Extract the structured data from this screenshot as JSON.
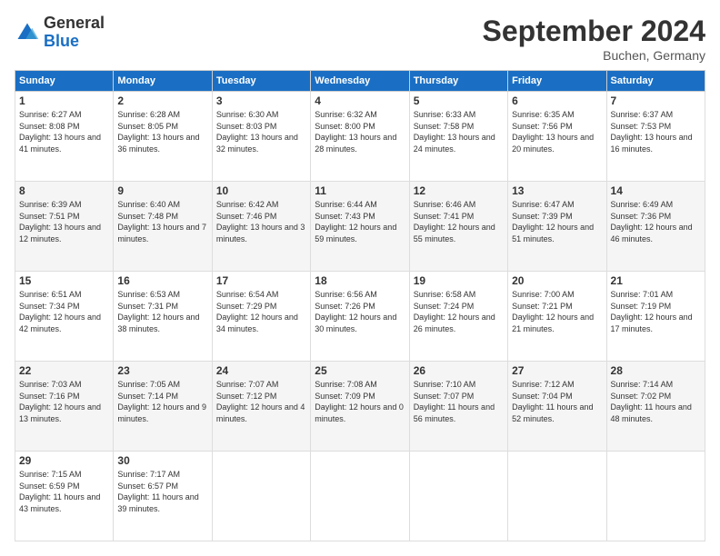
{
  "logo": {
    "general": "General",
    "blue": "Blue"
  },
  "header": {
    "month": "September 2024",
    "location": "Buchen, Germany"
  },
  "days": [
    "Sunday",
    "Monday",
    "Tuesday",
    "Wednesday",
    "Thursday",
    "Friday",
    "Saturday"
  ],
  "weeks": [
    [
      {
        "num": "1",
        "sunrise": "6:27 AM",
        "sunset": "8:08 PM",
        "daylight": "13 hours and 41 minutes."
      },
      {
        "num": "2",
        "sunrise": "6:28 AM",
        "sunset": "8:05 PM",
        "daylight": "13 hours and 36 minutes."
      },
      {
        "num": "3",
        "sunrise": "6:30 AM",
        "sunset": "8:03 PM",
        "daylight": "13 hours and 32 minutes."
      },
      {
        "num": "4",
        "sunrise": "6:32 AM",
        "sunset": "8:00 PM",
        "daylight": "13 hours and 28 minutes."
      },
      {
        "num": "5",
        "sunrise": "6:33 AM",
        "sunset": "7:58 PM",
        "daylight": "13 hours and 24 minutes."
      },
      {
        "num": "6",
        "sunrise": "6:35 AM",
        "sunset": "7:56 PM",
        "daylight": "13 hours and 20 minutes."
      },
      {
        "num": "7",
        "sunrise": "6:37 AM",
        "sunset": "7:53 PM",
        "daylight": "13 hours and 16 minutes."
      }
    ],
    [
      {
        "num": "8",
        "sunrise": "6:39 AM",
        "sunset": "7:51 PM",
        "daylight": "13 hours and 12 minutes."
      },
      {
        "num": "9",
        "sunrise": "6:40 AM",
        "sunset": "7:48 PM",
        "daylight": "13 hours and 7 minutes."
      },
      {
        "num": "10",
        "sunrise": "6:42 AM",
        "sunset": "7:46 PM",
        "daylight": "13 hours and 3 minutes."
      },
      {
        "num": "11",
        "sunrise": "6:44 AM",
        "sunset": "7:43 PM",
        "daylight": "12 hours and 59 minutes."
      },
      {
        "num": "12",
        "sunrise": "6:46 AM",
        "sunset": "7:41 PM",
        "daylight": "12 hours and 55 minutes."
      },
      {
        "num": "13",
        "sunrise": "6:47 AM",
        "sunset": "7:39 PM",
        "daylight": "12 hours and 51 minutes."
      },
      {
        "num": "14",
        "sunrise": "6:49 AM",
        "sunset": "7:36 PM",
        "daylight": "12 hours and 46 minutes."
      }
    ],
    [
      {
        "num": "15",
        "sunrise": "6:51 AM",
        "sunset": "7:34 PM",
        "daylight": "12 hours and 42 minutes."
      },
      {
        "num": "16",
        "sunrise": "6:53 AM",
        "sunset": "7:31 PM",
        "daylight": "12 hours and 38 minutes."
      },
      {
        "num": "17",
        "sunrise": "6:54 AM",
        "sunset": "7:29 PM",
        "daylight": "12 hours and 34 minutes."
      },
      {
        "num": "18",
        "sunrise": "6:56 AM",
        "sunset": "7:26 PM",
        "daylight": "12 hours and 30 minutes."
      },
      {
        "num": "19",
        "sunrise": "6:58 AM",
        "sunset": "7:24 PM",
        "daylight": "12 hours and 26 minutes."
      },
      {
        "num": "20",
        "sunrise": "7:00 AM",
        "sunset": "7:21 PM",
        "daylight": "12 hours and 21 minutes."
      },
      {
        "num": "21",
        "sunrise": "7:01 AM",
        "sunset": "7:19 PM",
        "daylight": "12 hours and 17 minutes."
      }
    ],
    [
      {
        "num": "22",
        "sunrise": "7:03 AM",
        "sunset": "7:16 PM",
        "daylight": "12 hours and 13 minutes."
      },
      {
        "num": "23",
        "sunrise": "7:05 AM",
        "sunset": "7:14 PM",
        "daylight": "12 hours and 9 minutes."
      },
      {
        "num": "24",
        "sunrise": "7:07 AM",
        "sunset": "7:12 PM",
        "daylight": "12 hours and 4 minutes."
      },
      {
        "num": "25",
        "sunrise": "7:08 AM",
        "sunset": "7:09 PM",
        "daylight": "12 hours and 0 minutes."
      },
      {
        "num": "26",
        "sunrise": "7:10 AM",
        "sunset": "7:07 PM",
        "daylight": "11 hours and 56 minutes."
      },
      {
        "num": "27",
        "sunrise": "7:12 AM",
        "sunset": "7:04 PM",
        "daylight": "11 hours and 52 minutes."
      },
      {
        "num": "28",
        "sunrise": "7:14 AM",
        "sunset": "7:02 PM",
        "daylight": "11 hours and 48 minutes."
      }
    ],
    [
      {
        "num": "29",
        "sunrise": "7:15 AM",
        "sunset": "6:59 PM",
        "daylight": "11 hours and 43 minutes."
      },
      {
        "num": "30",
        "sunrise": "7:17 AM",
        "sunset": "6:57 PM",
        "daylight": "11 hours and 39 minutes."
      },
      null,
      null,
      null,
      null,
      null
    ]
  ]
}
